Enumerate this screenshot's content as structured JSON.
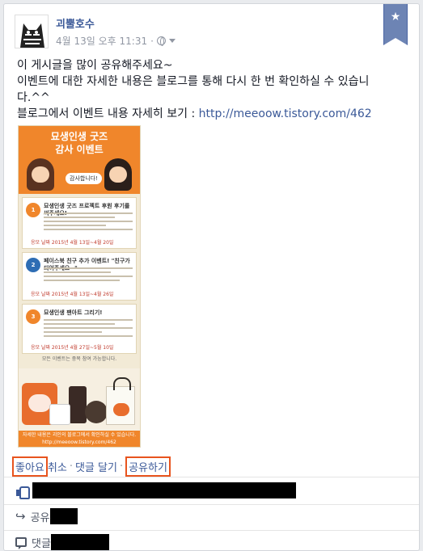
{
  "post": {
    "author": "괴뿔호수",
    "timestamp": "4월 13일 오후 11:31",
    "separator": "·",
    "lines": [
      "이 게시글을 많이 공유해주세요~",
      "이벤트에 대한 자세한 내용은 블로그를 통해 다시 한 번 확인하실 수 있습니",
      "다.^^",
      "블로그에서 이벤트 내용 자세히 보기 : "
    ],
    "link": "http://meeoow.tistory.com/462"
  },
  "poster": {
    "title1": "묘생인생 굿즈",
    "title2": "감사 이벤트",
    "bubble": "감사합니다!",
    "sections": [
      {
        "badge": "이벤트 1",
        "title": "묘생인생 굿즈 프로젝트 후원 후기를 써주세요!",
        "date": "응모 날짜 2015년 4월 13일~4월 20일",
        "color": "#f0862b"
      },
      {
        "badge": "이벤트 2",
        "title": "페이스북 친구 추가 이벤트! \"친구가 되어주세요~\"",
        "date": "응모 날짜 2015년 4월 13일~4월 26일",
        "color": "#2e6db4"
      },
      {
        "badge": "이벤트 3",
        "title": "묘생인생 팬아트 그리기!",
        "date": "응모 날짜 2015년 4월 27일~5월 10일",
        "color": "#f0862b"
      }
    ],
    "mid": "모든 이벤트는 중복 참여 가능합니다.",
    "footer1": "자세한 내용은 괴인의 블로그에서 확인하실 수 있습니다.",
    "footer2": "http://meeoow.tistory.com/462"
  },
  "actions": {
    "like": "좋아요",
    "cancel": "취소",
    "dot": "·",
    "comment": "댓글 달기",
    "share": "공유하기"
  },
  "summary": {
    "share_label": "공유",
    "comment_label": "댓글"
  },
  "colors": {
    "link": "#3b5998",
    "highlight": "#e8541e",
    "ribbon": "#6d84b4"
  }
}
